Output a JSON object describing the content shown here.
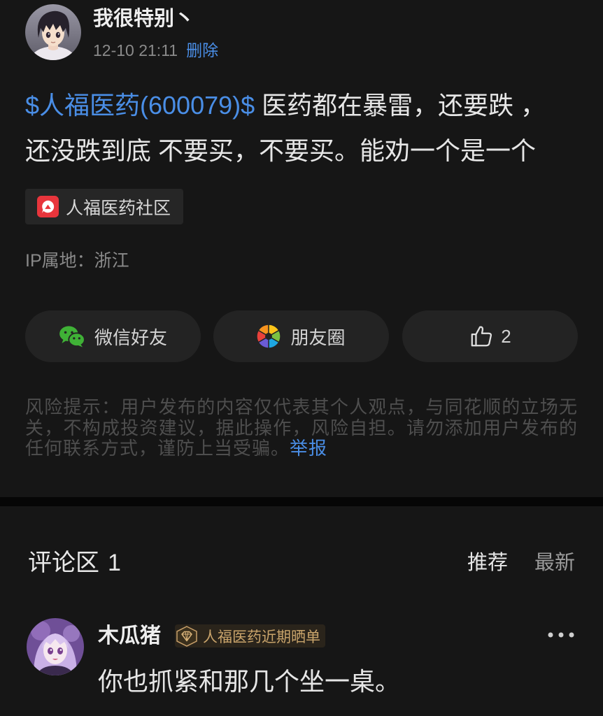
{
  "theme": {
    "background": "#161616",
    "surface": "#232323",
    "text_primary": "#e8e8e8",
    "text_secondary": "#8a8a8a",
    "text_muted": "#4e4e4e",
    "link": "#4a8ee6",
    "badge_gold": "#c9a46b",
    "brand_red": "#e8353c"
  },
  "post": {
    "author": {
      "name": "我很特别丶"
    },
    "time": "12-10 21:11",
    "delete_label": "删除",
    "stock_tag": "$人福医药(600079)$",
    "body_lines": [
      "医药都在暴雷，还要跌 ，",
      "还没跌到底 不要买，不要买。能劝一个是一个"
    ],
    "community": {
      "label": "人福医药社区",
      "icon": "community-logo-icon"
    },
    "ip_location": "IP属地：浙江"
  },
  "share_bar": {
    "wechat": {
      "label": "微信好友",
      "icon": "wechat-icon"
    },
    "moments": {
      "label": "朋友圈",
      "icon": "moments-icon"
    },
    "like": {
      "count": "2",
      "icon": "thumbs-up-icon"
    }
  },
  "disclaimer": {
    "text": "风险提示：用户发布的内容仅代表其个人观点，与同花顺的立场无关，不构成投资建议，据此操作，风险自担。请勿添加用户发布的任何联系方式，谨防上当受骗。",
    "report_label": "举报"
  },
  "comments": {
    "title": "评论区",
    "count": "1",
    "sort_tabs": [
      {
        "label": "推荐",
        "active": true
      },
      {
        "label": "最新",
        "active": false
      }
    ],
    "items": [
      {
        "author": "木瓜猪",
        "badge": "人福医药近期晒单",
        "badge_icon": "badge-crown-icon",
        "text": "你也抓紧和那几个坐一桌。",
        "menu_icon": "more-icon"
      }
    ]
  }
}
